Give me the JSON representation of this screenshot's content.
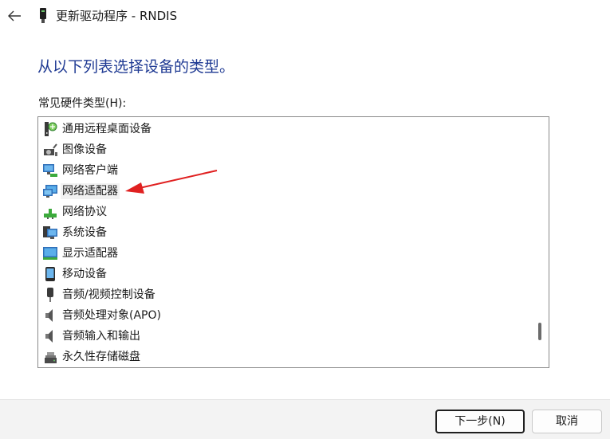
{
  "window": {
    "title": "更新驱动程序 - RNDIS"
  },
  "heading": "从以下列表选择设备的类型。",
  "list_label": "常见硬件类型(H):",
  "items": [
    {
      "label": "通用远程桌面设备",
      "icon": "remote-desktop-icon"
    },
    {
      "label": "图像设备",
      "icon": "camera-icon"
    },
    {
      "label": "网络客户端",
      "icon": "network-client-icon"
    },
    {
      "label": "网络适配器",
      "icon": "network-adapter-icon"
    },
    {
      "label": "网络协议",
      "icon": "network-protocol-icon"
    },
    {
      "label": "系统设备",
      "icon": "system-device-icon"
    },
    {
      "label": "显示适配器",
      "icon": "display-adapter-icon"
    },
    {
      "label": "移动设备",
      "icon": "mobile-device-icon"
    },
    {
      "label": "音频/视频控制设备",
      "icon": "av-control-icon"
    },
    {
      "label": "音频处理对象(APO)",
      "icon": "speaker-icon"
    },
    {
      "label": "音频输入和输出",
      "icon": "speaker-icon"
    },
    {
      "label": "永久性存储磁盘",
      "icon": "storage-disk-icon"
    }
  ],
  "buttons": {
    "next": "下一步(N)",
    "cancel": "取消"
  },
  "colors": {
    "heading": "#1f3a93",
    "annotation_arrow": "#e02020"
  }
}
